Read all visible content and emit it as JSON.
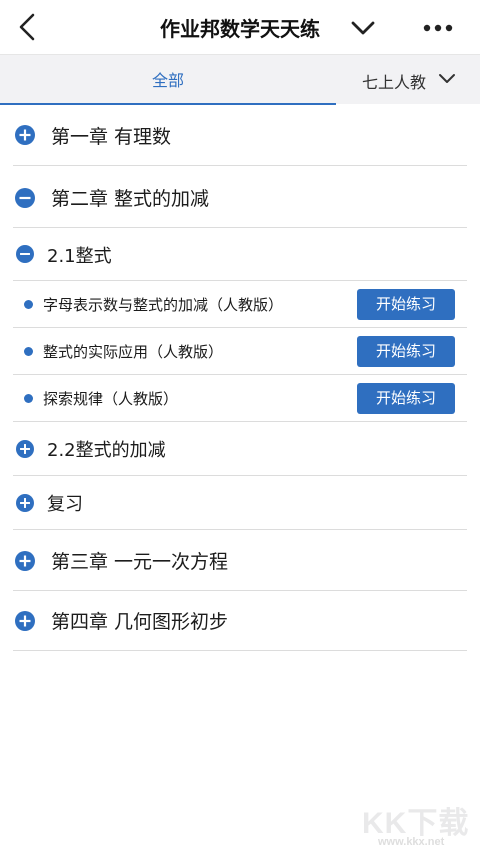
{
  "header": {
    "title": "作业邦数学天天练",
    "icons": {
      "back": "chevron-left-icon",
      "dropdown": "chevron-down-icon",
      "more": "more-horizontal-icon"
    }
  },
  "tabs": {
    "all_label": "全部",
    "grade_label": "七上人教"
  },
  "colors": {
    "accent": "#2f6fc0",
    "divider": "#dcdcdc",
    "tabbar_bg": "#f2f2f4"
  },
  "chapters": [
    {
      "label": "第一章 有理数",
      "state": "collapsed"
    },
    {
      "label": "第二章 整式的加减",
      "state": "expanded"
    },
    {
      "label": "第三章 一元一次方程",
      "state": "collapsed"
    },
    {
      "label": "第四章 几何图形初步",
      "state": "collapsed"
    }
  ],
  "sections": [
    {
      "label": "2.1整式",
      "state": "expanded"
    },
    {
      "label": "2.2整式的加减",
      "state": "collapsed"
    },
    {
      "label": "复习",
      "state": "collapsed"
    }
  ],
  "lessons": [
    {
      "label": "字母表示数与整式的加减（人教版）",
      "button": "开始练习"
    },
    {
      "label": "整式的实际应用（人教版）",
      "button": "开始练习"
    },
    {
      "label": "探索规律（人教版）",
      "button": "开始练习"
    }
  ],
  "watermark": {
    "main": "KK下载",
    "sub": "www.kkx.net"
  }
}
